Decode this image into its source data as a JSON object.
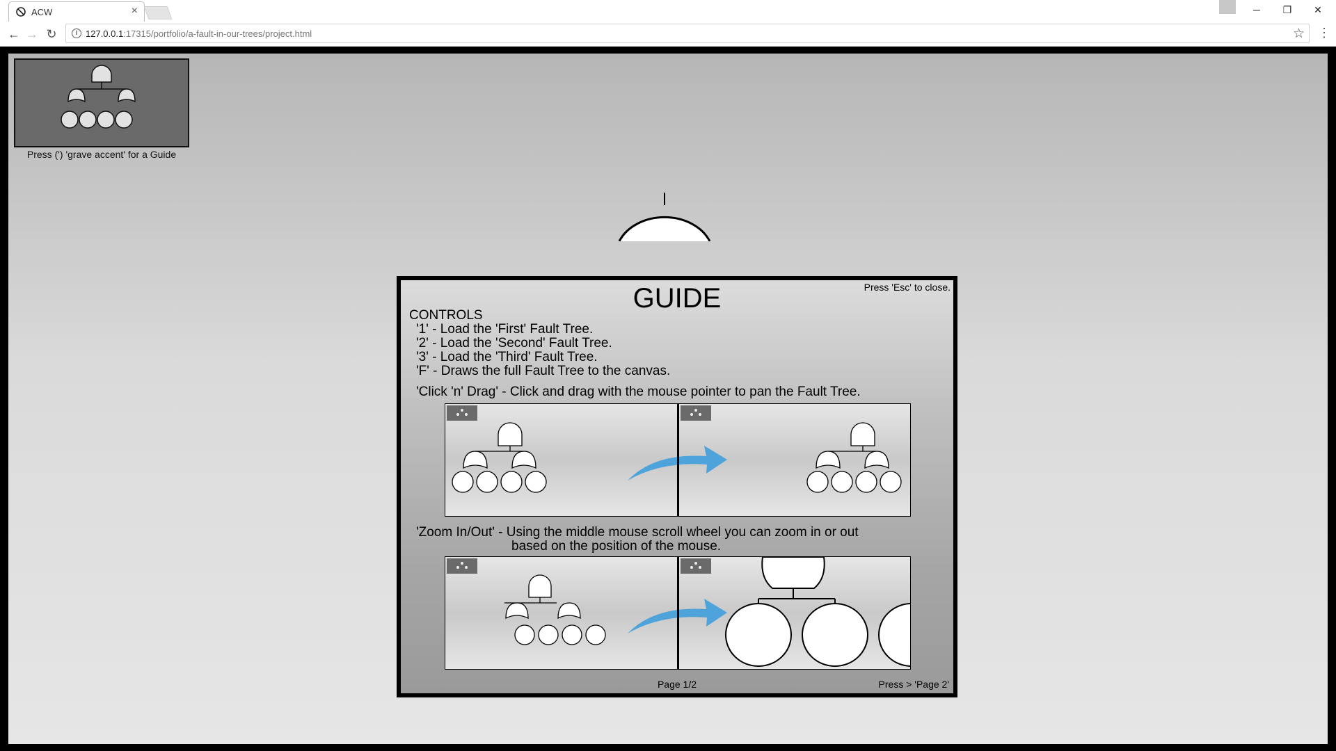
{
  "browser": {
    "tab_title": "ACW",
    "tab_close": "×",
    "url_host": "127.0.0.1",
    "url_rest": ":17315/portfolio/a-fault-in-our-trees/project.html",
    "win_minimize": "─",
    "win_restore": "❐",
    "win_close": "✕",
    "nav_back": "←",
    "nav_forward": "→",
    "nav_reload": "↻",
    "star": "☆",
    "menu": "⋮",
    "info": "i"
  },
  "page": {
    "thumbnail_caption": "Press (') 'grave accent' for a Guide"
  },
  "guide": {
    "title": "GUIDE",
    "esc_hint": "Press 'Esc' to close.",
    "controls_title": "CONTROLS",
    "controls": [
      "'1' - Load the 'First' Fault Tree.",
      "'2' - Load the 'Second' Fault Tree.",
      "'3' - Load the 'Third' Fault Tree.",
      "'F' - Draws the full Fault Tree to the canvas."
    ],
    "drag_text": "'Click 'n' Drag' - Click and drag with the mouse pointer to pan the Fault Tree.",
    "zoom_text_1": "'Zoom In/Out' - Using the middle mouse scroll wheel you can zoom in or out",
    "zoom_text_2": "based on the position of the mouse.",
    "page_num": "Page 1/2",
    "next_hint": "Press > 'Page 2'"
  },
  "colors": {
    "arrow": "#4ea3db",
    "thumb_bg": "#6a6a6a",
    "canvas_top": "#b6b6b6",
    "canvas_bottom": "#e6e6e6"
  }
}
